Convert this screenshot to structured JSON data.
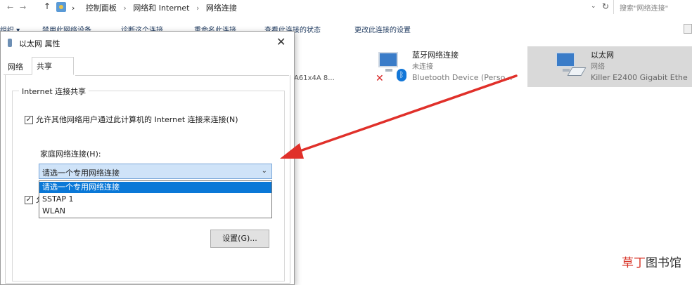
{
  "explorer": {
    "nav": {
      "back": "←",
      "forward": "→",
      "up": "↑"
    },
    "breadcrumb": [
      "控制面板",
      "网络和 Internet",
      "网络连接"
    ],
    "breadcrumb_sep": "›",
    "refresh": "↻",
    "dropdown": "⌄",
    "search_placeholder": "搜索\"网络连接\"",
    "toolbar": [
      "组织 ▾",
      "禁用此网络设备",
      "诊断这个连接",
      "重命名此连接",
      "查看此连接的状态",
      "更改此连接的设置"
    ],
    "partial_device_text": "A61x4A 8...",
    "connections": [
      {
        "name": "蓝牙网络连接",
        "status": "未连接",
        "device": "Bluetooth Device (Perso..."
      },
      {
        "name": "以太网",
        "status": "网络",
        "device": "Killer E2400 Gigabit Ethe"
      }
    ]
  },
  "dialog": {
    "title": "以太网 属性",
    "close": "✕",
    "tabs": [
      "网络",
      "共享"
    ],
    "group_title": "Internet 连接共享",
    "allow_share_label": "允许其他网络用户通过此计算机的 Internet 连接来连接(N)",
    "allow_share_checked": "✓",
    "home_network_label": "家庭网络连接(H):",
    "combo_value": "请选一个专用网络连接",
    "combo_arrow": "⌄",
    "options": [
      "请选一个专用网络连接",
      "SSTAP 1",
      "WLAN"
    ],
    "second_checkbox_checked": "✓",
    "second_checkbox_fragment": "允",
    "settings_button": "设置(G)..."
  },
  "watermark": {
    "part1": "草丁",
    "part2": "图书馆"
  },
  "annotation_color": "#e0302a"
}
